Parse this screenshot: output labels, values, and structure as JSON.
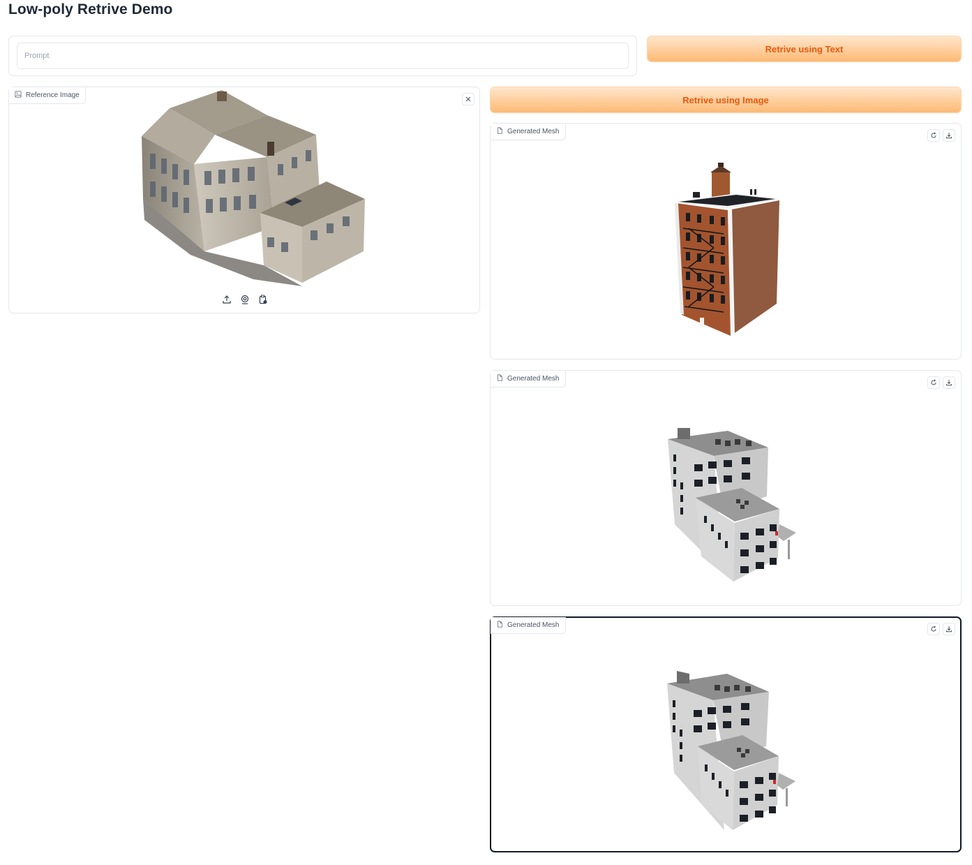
{
  "app": {
    "title": "Low-poly Retrive Demo"
  },
  "prompt": {
    "placeholder": "Prompt",
    "value": ""
  },
  "buttons": {
    "retrieve_text": "Retrive using Text",
    "retrieve_image": "Retrive using Image"
  },
  "reference": {
    "label": "Reference Image",
    "icon": "image-icon",
    "close_icon": "close-icon",
    "source_icons": [
      "upload-icon",
      "webcam-icon",
      "clipboard-icon"
    ]
  },
  "meshes": [
    {
      "label": "Generated Mesh",
      "icon": "file-icon",
      "tools": [
        "reset-icon",
        "download-icon"
      ]
    },
    {
      "label": "Generated Mesh",
      "icon": "file-icon",
      "tools": [
        "reset-icon",
        "download-icon"
      ]
    },
    {
      "label": "Generated Mesh",
      "icon": "file-icon",
      "tools": [
        "reset-icon",
        "download-icon"
      ]
    }
  ],
  "colors": {
    "accent": "#ea580c",
    "button_gradient_top": "#ffe6cc",
    "button_gradient_bottom": "#fdba74",
    "border": "#e5e7eb"
  }
}
